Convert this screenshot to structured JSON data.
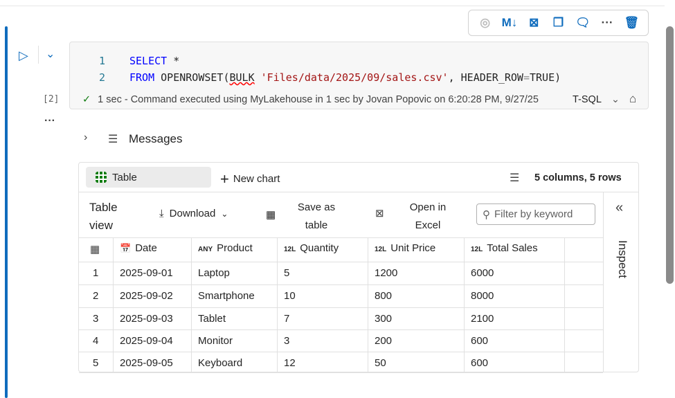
{
  "cell_toolbar": {
    "items": [
      "copilot",
      "markdown",
      "clear-output",
      "duplicate",
      "comment",
      "more",
      "delete"
    ],
    "md_label": "M↓",
    "more_label": "···"
  },
  "cell": {
    "exec_count": "[2]",
    "more_label": "···",
    "code": {
      "line1_no": "1",
      "line1_kw": "SELECT",
      "line1_rest": " *",
      "line2_no": "2",
      "line2_from": "FROM",
      "line2_fn": "OPENROWSET(",
      "line2_bulk": "BULK",
      "line2_str": "'Files/data/2025/09/sales.csv'",
      "line2_rest": ", HEADER_ROW",
      "line2_eq": "=",
      "line2_true": "TRUE)"
    },
    "status": {
      "duration": "1 sec",
      "message": " - Command executed using MyLakehouse in 1 sec by Jovan Popovic on 6:20:28 PM, 9/27/25"
    },
    "language": "T-SQL"
  },
  "messages_label": "Messages",
  "output": {
    "tabs": {
      "table": "Table",
      "new_chart": "New chart"
    },
    "summary": "5 columns, 5 rows",
    "toolbar": {
      "title_1": "Table",
      "title_2": "view",
      "download": "Download",
      "save_1": "Save as",
      "save_2": "table",
      "open_1": "Open in",
      "open_2": "Excel",
      "filter_placeholder": "Filter by keyword"
    },
    "inspect": "Inspect",
    "columns": [
      {
        "type": "",
        "name": "Date"
      },
      {
        "type": "ANY",
        "name": "Product"
      },
      {
        "type": "12L",
        "name": "Quantity"
      },
      {
        "type": "12L",
        "name": "Unit Price"
      },
      {
        "type": "12L",
        "name": "Total Sales"
      }
    ],
    "rows": [
      [
        "1",
        "2025-09-01",
        "Laptop",
        "5",
        "1200",
        "6000"
      ],
      [
        "2",
        "2025-09-02",
        "Smartphone",
        "10",
        "800",
        "8000"
      ],
      [
        "3",
        "2025-09-03",
        "Tablet",
        "7",
        "300",
        "2100"
      ],
      [
        "4",
        "2025-09-04",
        "Monitor",
        "3",
        "200",
        "600"
      ],
      [
        "5",
        "2025-09-05",
        "Keyboard",
        "12",
        "50",
        "600"
      ]
    ]
  }
}
